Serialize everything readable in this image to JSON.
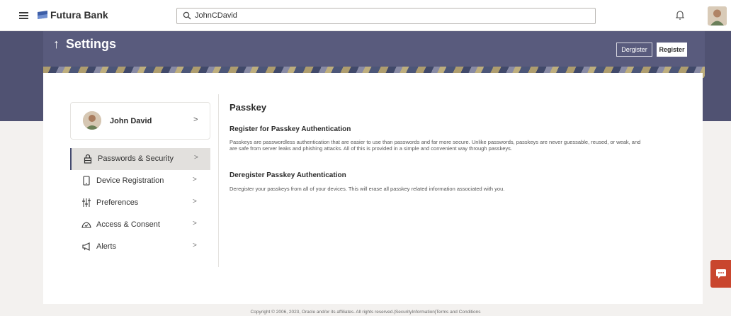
{
  "header": {
    "brand": "Futura Bank",
    "search_value": "JohnCDavid"
  },
  "page": {
    "title": "Settings",
    "deregister_label": "Dergister",
    "register_label": "Register"
  },
  "profile": {
    "name": "John David"
  },
  "menu": [
    {
      "label": "Passwords & Security",
      "icon": "lock-icon",
      "active": true
    },
    {
      "label": "Device Registration",
      "icon": "phone-icon"
    },
    {
      "label": "Preferences",
      "icon": "sliders-icon"
    },
    {
      "label": "Access & Consent",
      "icon": "hand-icon"
    },
    {
      "label": "Alerts",
      "icon": "megaphone-icon"
    }
  ],
  "content": {
    "heading": "Passkey",
    "register_heading": "Register for Passkey Authentication",
    "register_text": "Passkeys are passwordless authentication that are easier to use than passwords and far more secure. Unlike passwords, passkeys are never guessable, reused, or weak, and are safe from server leaks and phishing attacks. All of this is provided in a simple and convenient way through passkeys.",
    "deregister_heading": "Deregister Passkey Authentication",
    "deregister_text": "Deregister your passkeys from all of your devices. This will erase all passkey related information associated with you."
  },
  "footer": {
    "text": "Copyright © 2006, 2023, Oracle and/or its affiliates. All rights reserved.|SecurityInformation|Terms and Conditions"
  },
  "colors": {
    "banner": "#505272",
    "accent": "#434a6f",
    "chat": "#c9462e"
  }
}
